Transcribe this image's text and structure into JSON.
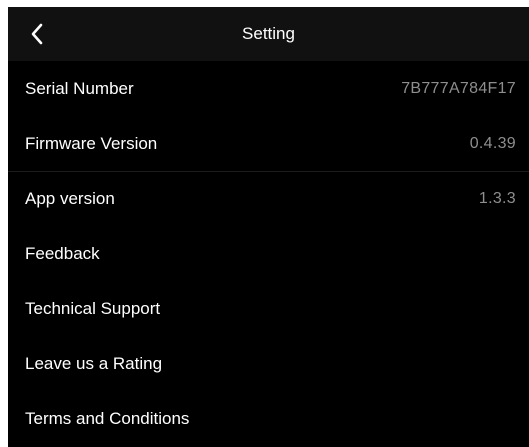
{
  "header": {
    "title": "Setting",
    "back_icon": "chevron-left-icon"
  },
  "settings": {
    "serial": {
      "label": "Serial Number",
      "value": "7B777A784F17"
    },
    "firmware": {
      "label": "Firmware Version",
      "value": "0.4.39"
    },
    "app": {
      "label": "App version",
      "value": "1.3.3"
    },
    "feedback": {
      "label": "Feedback"
    },
    "support": {
      "label": "Technical Support"
    },
    "rating": {
      "label": "Leave us a Rating"
    },
    "terms": {
      "label": "Terms and Conditions"
    }
  },
  "colors": {
    "background": "#000000",
    "header_background": "#111111",
    "text": "#ffffff",
    "secondary_text": "#8e8e8e"
  }
}
